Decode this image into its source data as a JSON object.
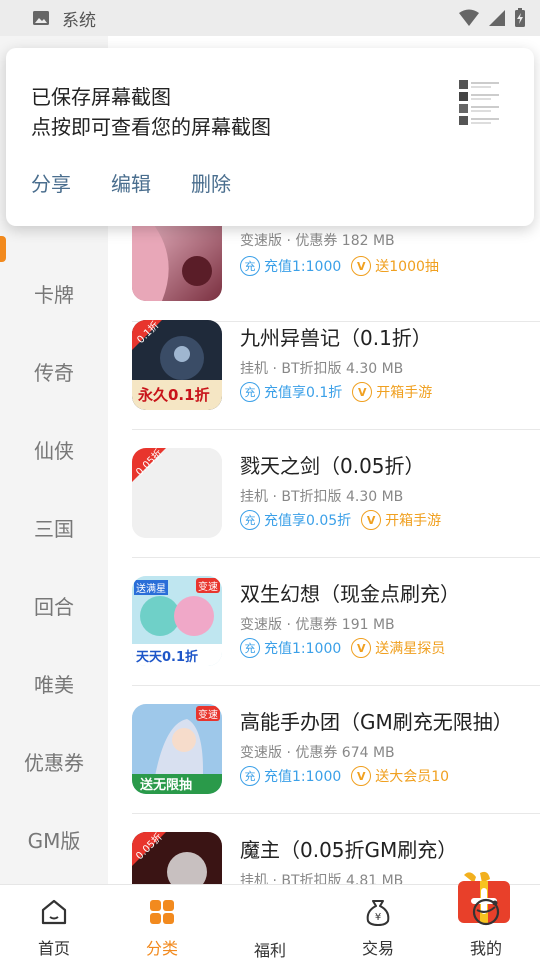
{
  "status_bar": {
    "app_label": "系统"
  },
  "notification": {
    "title": "已保存屏幕截图",
    "subtitle": "点按即可查看您的屏幕截图",
    "actions": [
      "分享",
      "编辑",
      "删除"
    ]
  },
  "categories": [
    "卡牌",
    "传奇",
    "仙侠",
    "三国",
    "回合",
    "唯美",
    "优惠券",
    "GM版"
  ],
  "games": [
    {
      "name": "",
      "meta": "变速版 · 优惠券  182 MB",
      "tag1_icon": "充",
      "tag1": "充值1:1000",
      "tag2_icon": "V",
      "tag2": "送1000抽",
      "art": "pink"
    },
    {
      "name": "九州异兽记（0.1折）",
      "meta": "挂机 · BT折扣版  4.30 MB",
      "tag1_icon": "充",
      "tag1": "充值享0.1折",
      "tag2_icon": "V",
      "tag2": "开箱手游",
      "art": "dark",
      "corner": "0.1折",
      "banner": "永久0.1折"
    },
    {
      "name": "戮天之剑（0.05折）",
      "meta": "挂机 · BT折扣版  4.30 MB",
      "tag1_icon": "充",
      "tag1": "充值享0.05折",
      "tag2_icon": "V",
      "tag2": "开箱手游",
      "art": "blank",
      "corner": "0.05折"
    },
    {
      "name": "双生幻想（现金点刷充）",
      "meta": "变速版 · 优惠券  191 MB",
      "tag1_icon": "充",
      "tag1": "充值1:1000",
      "tag2_icon": "V",
      "tag2": "送满星探员",
      "art": "anime",
      "corner": "送满星",
      "badge": "变速",
      "banner": "天天0.1折"
    },
    {
      "name": "高能手办团（GM刷充无限抽）",
      "meta": "变速版 · 优惠券  674 MB",
      "tag1_icon": "充",
      "tag1": "充值1:1000",
      "tag2_icon": "V",
      "tag2": "送大会员10",
      "art": "girl",
      "badge": "变速",
      "banner": "送无限抽"
    },
    {
      "name": "魔主（0.05折GM刷充）",
      "meta": "挂机 · BT折扣版  4.81 MB",
      "tag1_icon": "充",
      "tag1": "",
      "tag2_icon": "V",
      "tag2": "",
      "art": "red",
      "corner": "0.05折"
    }
  ],
  "tabs": [
    "首页",
    "分类",
    "福利",
    "交易",
    "我的"
  ],
  "colors": {
    "accent": "#f28a1e",
    "blue_tag": "#3ba0e8",
    "gold_tag": "#f0a020",
    "action_text": "#4a6e8e"
  }
}
